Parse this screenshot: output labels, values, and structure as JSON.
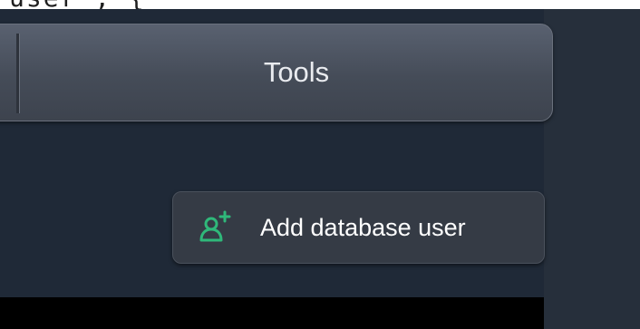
{
  "top_strip": {
    "partial_text": "user\", {"
  },
  "tools_tab": {
    "label": "Tools"
  },
  "add_user_button": {
    "icon": "add-user-icon",
    "label": "Add database user"
  },
  "colors": {
    "accent_green": "#2fb87a",
    "background": "#1f2937"
  }
}
